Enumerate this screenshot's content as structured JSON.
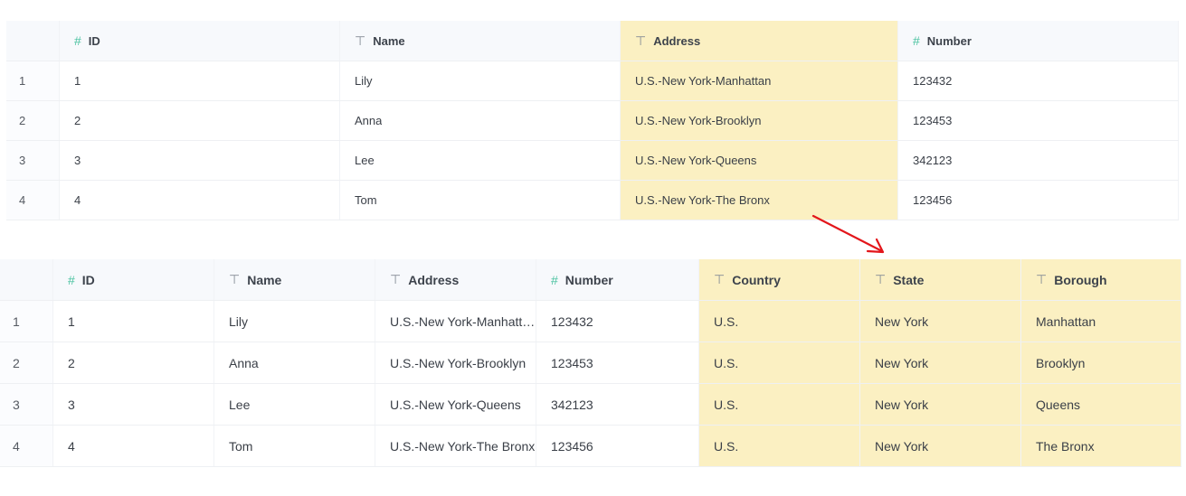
{
  "colors": {
    "highlight": "#fbf0c2",
    "arrow": "#e3161b",
    "number_icon": "#4cc3a1"
  },
  "icons": {
    "number_type": "hash-icon",
    "text_type": "text-type-icon"
  },
  "before_table": {
    "columns": [
      {
        "label": "ID",
        "type": "number",
        "icon": "#"
      },
      {
        "label": "Name",
        "type": "text",
        "icon": "⊤"
      },
      {
        "label": "Address",
        "type": "text",
        "icon": "⊤",
        "highlighted": true
      },
      {
        "label": "Number",
        "type": "number",
        "icon": "#"
      }
    ],
    "rows": [
      {
        "index": "1",
        "cells": [
          "1",
          "Lily",
          "U.S.-New York-Manhattan",
          "123432"
        ]
      },
      {
        "index": "2",
        "cells": [
          "2",
          "Anna",
          "U.S.-New York-Brooklyn",
          "123453"
        ]
      },
      {
        "index": "3",
        "cells": [
          "3",
          "Lee",
          "U.S.-New York-Queens",
          "342123"
        ]
      },
      {
        "index": "4",
        "cells": [
          "4",
          "Tom",
          "U.S.-New York-The Bronx",
          "123456"
        ]
      }
    ]
  },
  "after_table": {
    "columns": [
      {
        "label": "ID",
        "type": "number",
        "icon": "#"
      },
      {
        "label": "Name",
        "type": "text",
        "icon": "⊤"
      },
      {
        "label": "Address",
        "type": "text",
        "icon": "⊤"
      },
      {
        "label": "Number",
        "type": "number",
        "icon": "#"
      },
      {
        "label": "Country",
        "type": "text",
        "icon": "⊤",
        "highlighted": true
      },
      {
        "label": "State",
        "type": "text",
        "icon": "⊤",
        "highlighted": true
      },
      {
        "label": "Borough",
        "type": "text",
        "icon": "⊤",
        "highlighted": true
      }
    ],
    "rows": [
      {
        "index": "1",
        "cells": [
          "1",
          "Lily",
          "U.S.-New York-Manhattan",
          "123432",
          "U.S.",
          "New York",
          "Manhattan"
        ]
      },
      {
        "index": "2",
        "cells": [
          "2",
          "Anna",
          "U.S.-New York-Brooklyn",
          "123453",
          "U.S.",
          "New York",
          "Brooklyn"
        ]
      },
      {
        "index": "3",
        "cells": [
          "3",
          "Lee",
          "U.S.-New York-Queens",
          "342123",
          "U.S.",
          "New York",
          "Queens"
        ]
      },
      {
        "index": "4",
        "cells": [
          "4",
          "Tom",
          "U.S.-New York-The Bronx",
          "123456",
          "U.S.",
          "New York",
          "The Bronx"
        ]
      }
    ]
  }
}
